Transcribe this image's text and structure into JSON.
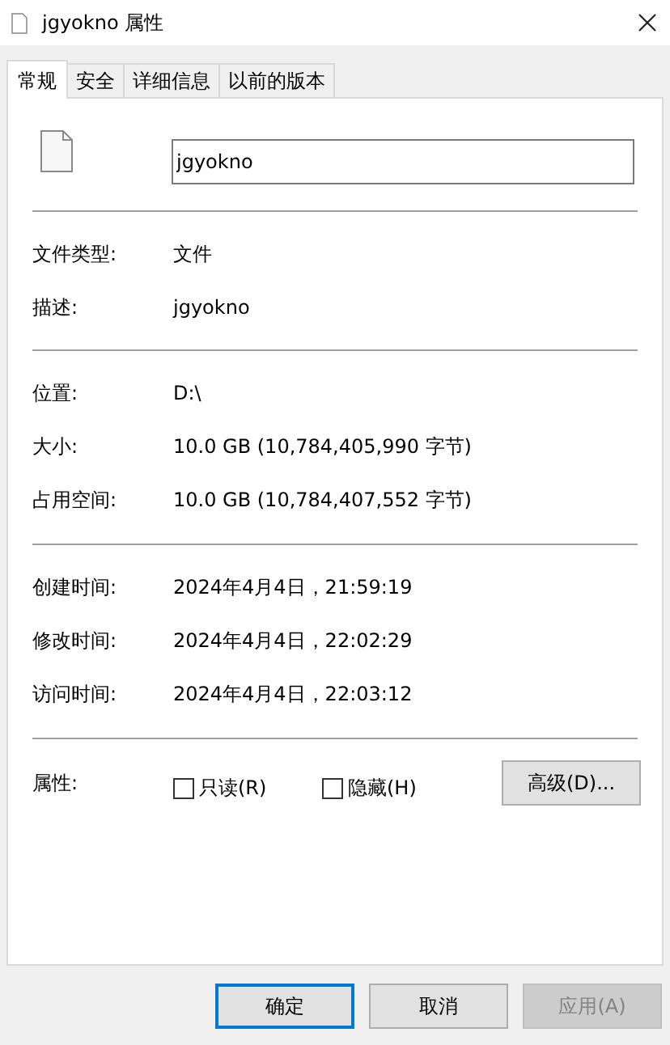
{
  "window": {
    "title": "jgyokno 属性"
  },
  "tabs": [
    {
      "label": "常规",
      "selected": true
    },
    {
      "label": "安全",
      "selected": false
    },
    {
      "label": "详细信息",
      "selected": false
    },
    {
      "label": "以前的版本",
      "selected": false
    }
  ],
  "name_field": {
    "value": "jgyokno"
  },
  "groups": [
    [
      {
        "label": "文件类型:",
        "value": "文件"
      },
      {
        "label": "描述:",
        "value": "jgyokno"
      }
    ],
    [
      {
        "label": "位置:",
        "value": "D:\\"
      },
      {
        "label": "大小:",
        "value": "10.0 GB (10,784,405,990 字节)"
      },
      {
        "label": "占用空间:",
        "value": "10.0 GB (10,784,407,552 字节)"
      }
    ],
    [
      {
        "label": "创建时间:",
        "value": "2024年4月4日，21:59:19"
      },
      {
        "label": "修改时间:",
        "value": "2024年4月4日，22:02:29"
      },
      {
        "label": "访问时间:",
        "value": "2024年4月4日，22:03:12"
      }
    ]
  ],
  "attributes": {
    "label": "属性:",
    "checkboxes": [
      {
        "label": "只读(R)",
        "checked": false
      },
      {
        "label": "隐藏(H)",
        "checked": false
      }
    ],
    "advanced_button": "高级(D)..."
  },
  "buttons": [
    {
      "label": "确定",
      "default": true,
      "disabled": false
    },
    {
      "label": "取消",
      "default": false,
      "disabled": false
    },
    {
      "label": "应用(A)",
      "default": false,
      "disabled": true
    }
  ]
}
